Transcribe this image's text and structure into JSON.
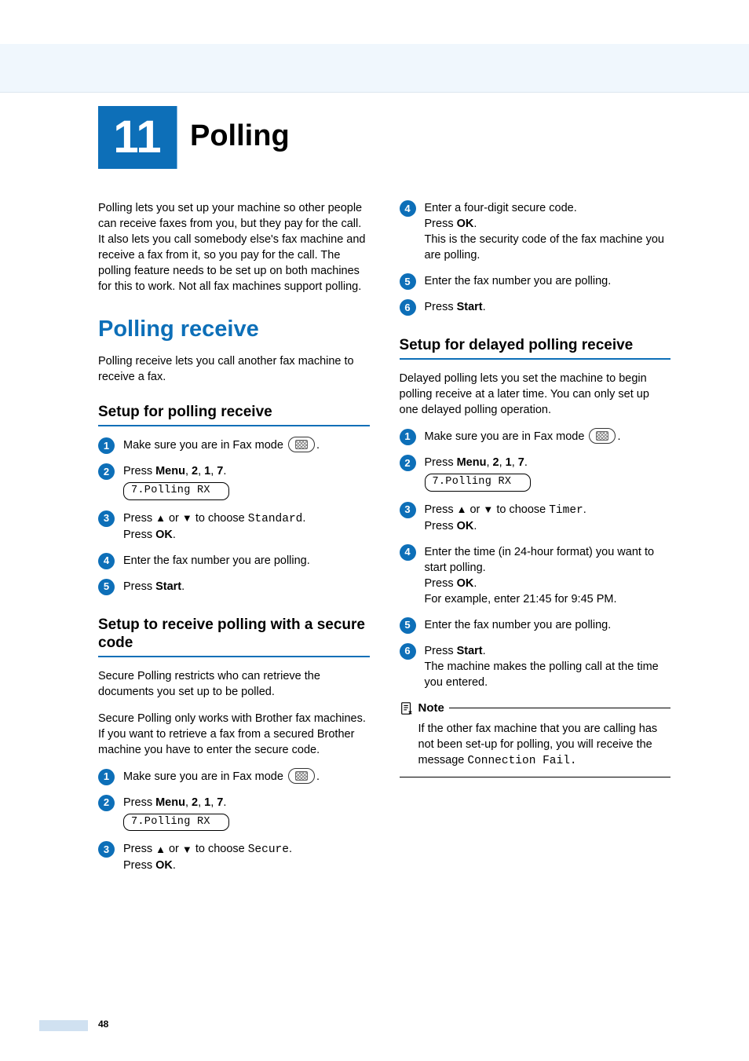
{
  "chapter": {
    "number": "11",
    "title": "Polling"
  },
  "intro": "Polling lets you set up your machine so other people can receive faxes from you, but they pay for the call. It also lets you call somebody else's fax machine and receive a fax from it, so you pay for the call. The polling feature needs to be set up on both machines for this to work. Not all fax machines support polling.",
  "pollreceive": {
    "title": "Polling receive",
    "intro": "Polling receive lets you call another fax machine to receive a fax."
  },
  "setup_pr": {
    "title": "Setup for polling receive",
    "steps": {
      "s1_a": "Make sure you are in Fax mode ",
      "s1_b": ".",
      "s2_a": "Press ",
      "s2_menu": "Menu",
      "s2_b": ", ",
      "s2_2": "2",
      "s2_c": ", ",
      "s2_1": "1",
      "s2_d": ", ",
      "s2_7": "7",
      "s2_e": ".",
      "lcd": "7.Polling RX",
      "s3_a": "Press ",
      "s3_b": " or ",
      "s3_c": " to choose ",
      "s3_v": "Standard",
      "s3_d": ".",
      "s3_e": "Press ",
      "s3_ok": "OK",
      "s3_f": ".",
      "s4": "Enter the fax number you are polling.",
      "s5_a": "Press ",
      "s5_start": "Start",
      "s5_b": "."
    }
  },
  "secure": {
    "title": "Setup to receive polling with a secure code",
    "p1": "Secure Polling restricts who can retrieve the documents you set up to be polled.",
    "p2": "Secure Polling only works with Brother fax machines. If you want to retrieve a fax from a secured Brother machine you have to enter the secure code.",
    "steps": {
      "s1_a": "Make sure you are in Fax mode ",
      "s1_b": ".",
      "s2_a": "Press ",
      "s2_menu": "Menu",
      "s2_b": ", ",
      "s2_2": "2",
      "s2_c": ", ",
      "s2_1": "1",
      "s2_d": ", ",
      "s2_7": "7",
      "s2_e": ".",
      "lcd": "7.Polling RX",
      "s3_a": "Press ",
      "s3_b": " or ",
      "s3_c": " to choose ",
      "s3_v": "Secure",
      "s3_d": ".",
      "s3_e": "Press ",
      "s3_ok": "OK",
      "s3_f": ".",
      "s4_a": "Enter a four-digit secure code.",
      "s4_b": "Press ",
      "s4_ok": "OK",
      "s4_c": ".",
      "s4_d": "This is the security code of the fax machine you are polling.",
      "s5": "Enter the fax number you are polling.",
      "s6_a": "Press ",
      "s6_start": "Start",
      "s6_b": "."
    }
  },
  "delayed": {
    "title": "Setup for delayed polling receive",
    "intro": "Delayed polling lets you set the machine to begin polling receive at a later time. You can only set up one delayed polling operation.",
    "steps": {
      "s1_a": "Make sure you are in Fax mode ",
      "s1_b": ".",
      "s2_a": "Press ",
      "s2_menu": "Menu",
      "s2_b": ", ",
      "s2_2": "2",
      "s2_c": ", ",
      "s2_1": "1",
      "s2_d": ", ",
      "s2_7": "7",
      "s2_e": ".",
      "lcd": "7.Polling RX",
      "s3_a": "Press ",
      "s3_b": " or ",
      "s3_c": " to choose ",
      "s3_v": "Timer",
      "s3_d": ".",
      "s3_e": "Press ",
      "s3_ok": "OK",
      "s3_f": ".",
      "s4_a": "Enter the time (in 24-hour format) you want to start polling.",
      "s4_b": "Press ",
      "s4_ok": "OK",
      "s4_c": ".",
      "s4_d": "For example, enter 21:45 for 9:45 PM.",
      "s5": "Enter the fax number you are polling.",
      "s6_a": "Press ",
      "s6_start": "Start",
      "s6_b": ".",
      "s6_c": "The machine makes the polling call at the time you entered."
    }
  },
  "note": {
    "label": "Note",
    "text_a": "If the other fax machine that you are calling has not been set-up for polling, you will receive the message ",
    "text_b": "Connection Fail."
  },
  "pageNumber": "48"
}
